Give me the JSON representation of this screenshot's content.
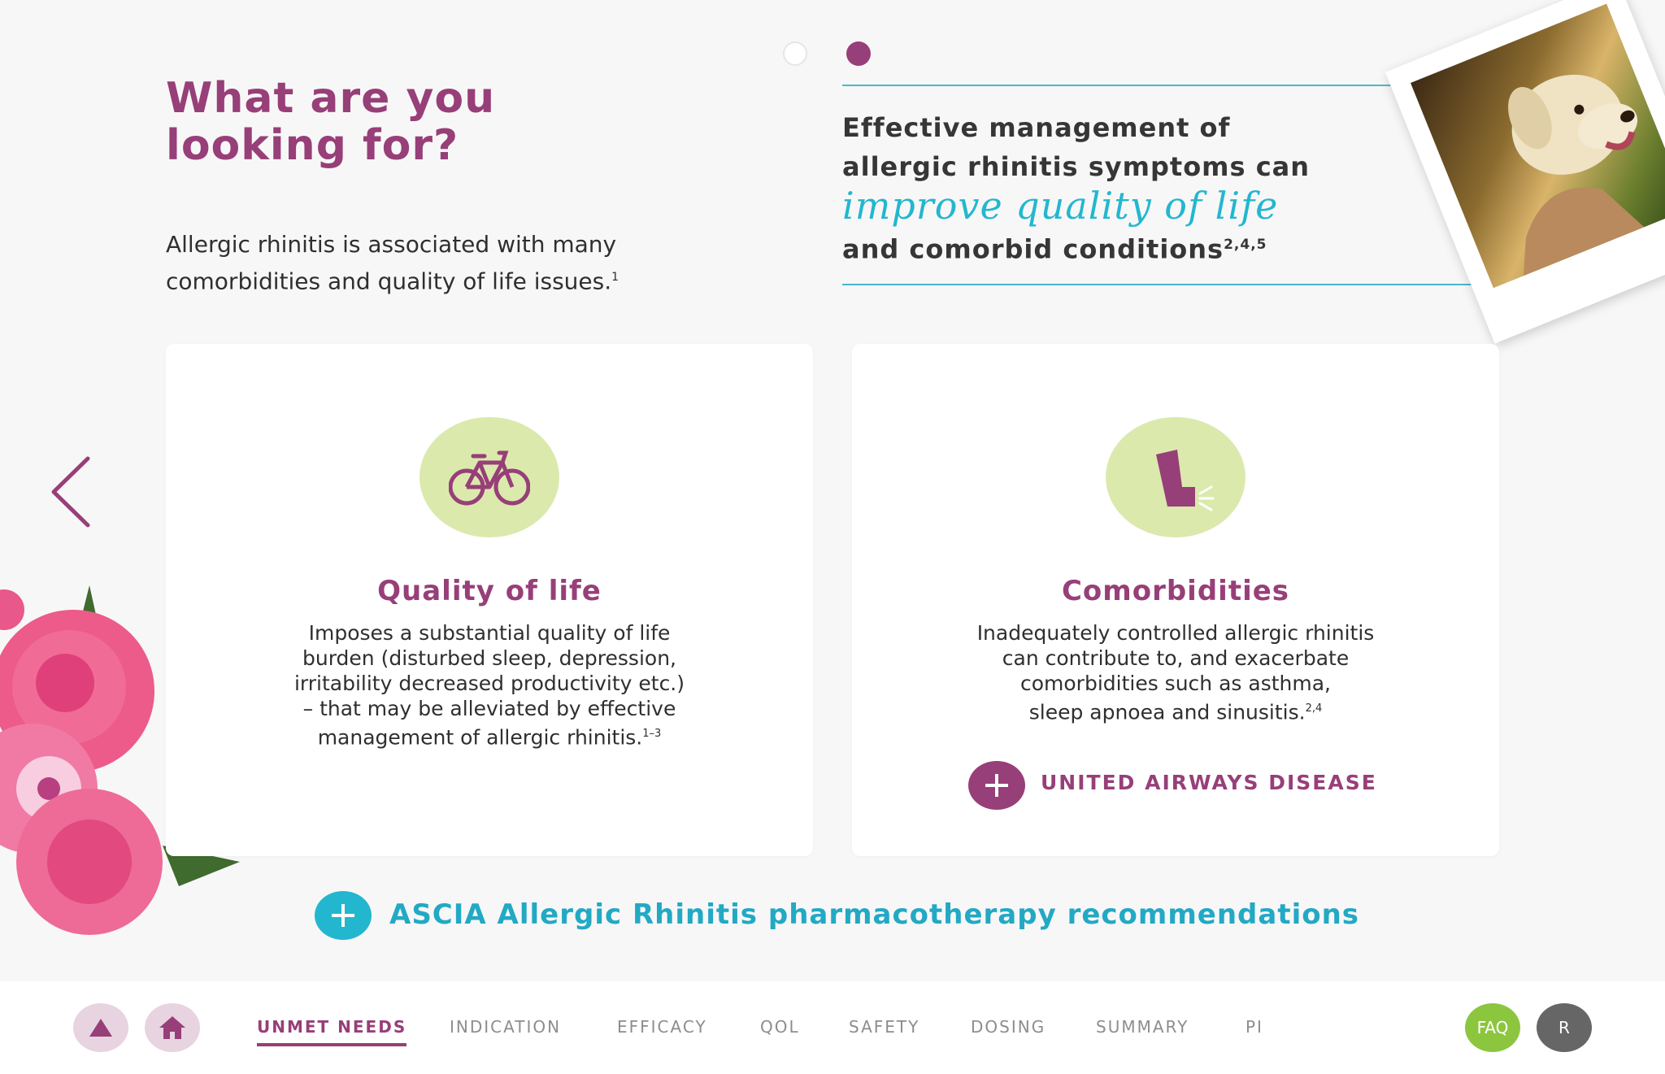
{
  "header": {
    "title_line1": "What are you",
    "title_line2": "looking for?",
    "intro_line1": "Allergic rhinitis is associated with many",
    "intro_line2": "comorbidities and quality of life issues.",
    "intro_ref": "1"
  },
  "pager": {
    "pages": 2,
    "current": 2
  },
  "quote": {
    "line1": "Effective management of",
    "line2": "allergic rhinitis symptoms can",
    "script": "improve quality of life",
    "line4": "and comorbid conditions",
    "ref": "2,4,5"
  },
  "cards": [
    {
      "icon": "bicycle-icon",
      "title": "Quality of life",
      "lines": [
        "Imposes a substantial quality of life",
        "burden (disturbed sleep, depression,",
        "irritability decreased productivity etc.)",
        "– that may be alleviated by effective",
        "management of allergic rhinitis."
      ],
      "ref": "1–3"
    },
    {
      "icon": "inhaler-icon",
      "title": "Comorbidities",
      "lines": [
        "Inadequately controlled allergic rhinitis",
        "can contribute to, and exacerbate",
        "comorbidities such as asthma,",
        "sleep apnoea and sinusitis."
      ],
      "ref": "2,4",
      "link": "UNITED AIRWAYS DISEASE"
    }
  ],
  "bottom_link": "ASCIA Allergic Rhinitis pharmacotherapy recommendations",
  "nav": {
    "tabs": [
      "UNMET NEEDS",
      "INDICATION",
      "EFFICACY",
      "QOL",
      "SAFETY",
      "DOSING",
      "SUMMARY",
      "PI"
    ],
    "active": "UNMET NEEDS",
    "faq_label": "FAQ",
    "r_label": "R"
  },
  "colors": {
    "purple": "#973f78",
    "teal": "#22b7cf",
    "green_circle": "#dbe9ad",
    "faq_green": "#8cc63f",
    "background": "#f8f7f8"
  }
}
